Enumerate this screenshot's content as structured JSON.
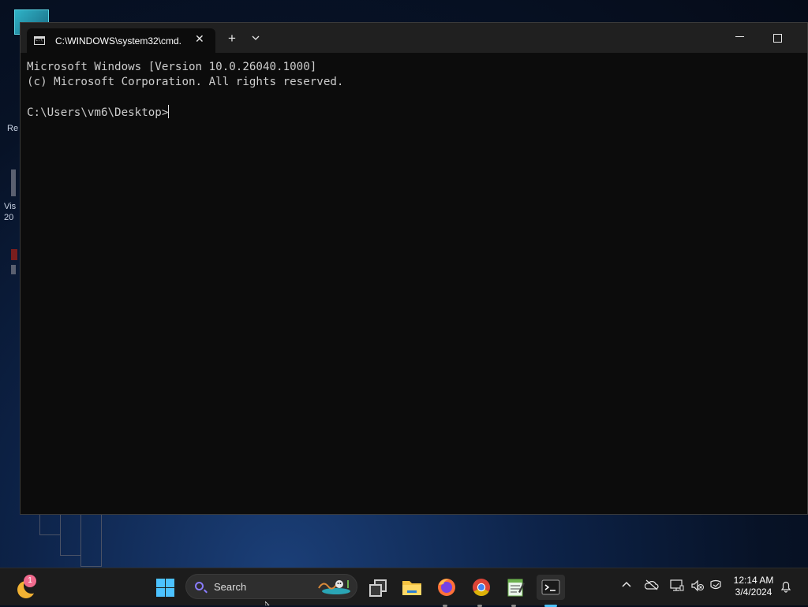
{
  "desktop": {
    "icon_fragments": [
      "Re",
      "Vis",
      "20"
    ]
  },
  "window": {
    "tab_title": "C:\\WINDOWS\\system32\\cmd.",
    "tab_icon_text": "C:\\",
    "close_tab_glyph": "✕",
    "new_tab_glyph": "+",
    "close_window_glyph": "✕"
  },
  "console": {
    "lines": [
      "Microsoft Windows [Version 10.0.26040.1000]",
      "(c) Microsoft Corporation. All rights reserved."
    ],
    "prompt": "C:\\Users\\vm6\\Desktop>"
  },
  "taskbar": {
    "weather_badge": "1",
    "search_label": "Search",
    "clock_time": "12:14 AM",
    "clock_date": "3/4/2024",
    "tray_icons": [
      "chevron-up-icon",
      "onedrive-offline-icon",
      "network-icon",
      "volume-muted-icon",
      "copilot-icon",
      "notification-bell-icon"
    ]
  },
  "colors": {
    "accent": "#4cc2ff",
    "console_bg": "#0c0c0c",
    "titlebar_bg": "#202020",
    "taskbar_bg": "#1c1c1c"
  }
}
